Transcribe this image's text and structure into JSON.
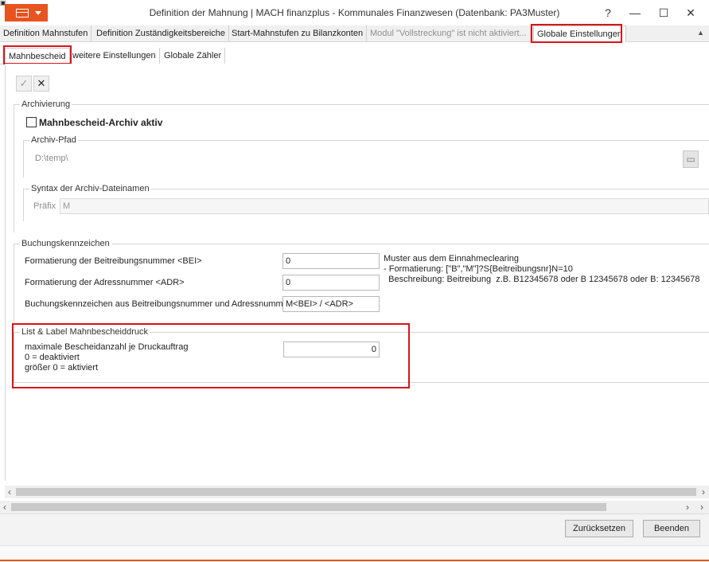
{
  "window": {
    "title": "Definition der Mahnung | MACH finanzplus - Kommunales Finanzwesen (Datenbank: PA3Muster)",
    "help": "?",
    "minimize": "—",
    "maximize": "☐",
    "close": "✕"
  },
  "tabs": [
    {
      "label": "Definition Mahnstufen"
    },
    {
      "label": "Definition Zuständigkeitsbereiche"
    },
    {
      "label": "Start-Mahnstufen zu Bilanzkonten"
    },
    {
      "label": "Modul \"Vollstreckung\" ist nicht aktiviert..."
    },
    {
      "label": "Globale Einstellungen"
    }
  ],
  "subtabs": [
    {
      "label": "Mahnbescheid"
    },
    {
      "label": "weitere Einstellungen"
    },
    {
      "label": "Globale Zähler"
    }
  ],
  "toolbar": {
    "confirm": "✓",
    "cancel": "✕"
  },
  "archiv": {
    "title": "Archivierung",
    "checkbox_label": "Mahnbescheid-Archiv aktiv",
    "checked": false,
    "pfad_title": "Archiv-Pfad",
    "pfad_value": "D:\\temp\\",
    "syntax_title": "Syntax der Archiv-Dateinamen",
    "praefix_label": "Präfix",
    "praefix_value": "M"
  },
  "buchung": {
    "title": "Buchungskennzeichen",
    "bei_label": "Formatierung der Beitreibungsnummer <BEI>",
    "bei_value": "0",
    "adr_label": "Formatierung der Adressnummer <ADR>",
    "adr_value": "0",
    "kz_label": "Buchungskennzeichen aus Beitreibungsnummer und Adressnummer",
    "kz_value": "M<BEI> / <ADR>",
    "hint_line1": "Muster aus dem Einnahmeclearing",
    "hint_line2": "- Formatierung: [\"B\",\"M\"]?S{Beitreibungsnr}N=10",
    "hint_line3": "  Beschreibung: Beitreibung  z.B. B12345678 oder B 12345678 oder B: 12345678"
  },
  "listlabel": {
    "title": "List & Label Mahnbescheiddruck",
    "line1": "maximale Bescheidanzahl je Druckauftrag",
    "line2": "0 = deaktiviert",
    "line3": "größer 0 = aktiviert",
    "value": "0"
  },
  "footer": {
    "reset": "Zurücksetzen",
    "close": "Beenden"
  },
  "colors": {
    "accent": "#e8541f",
    "highlight": "#d9141b"
  }
}
